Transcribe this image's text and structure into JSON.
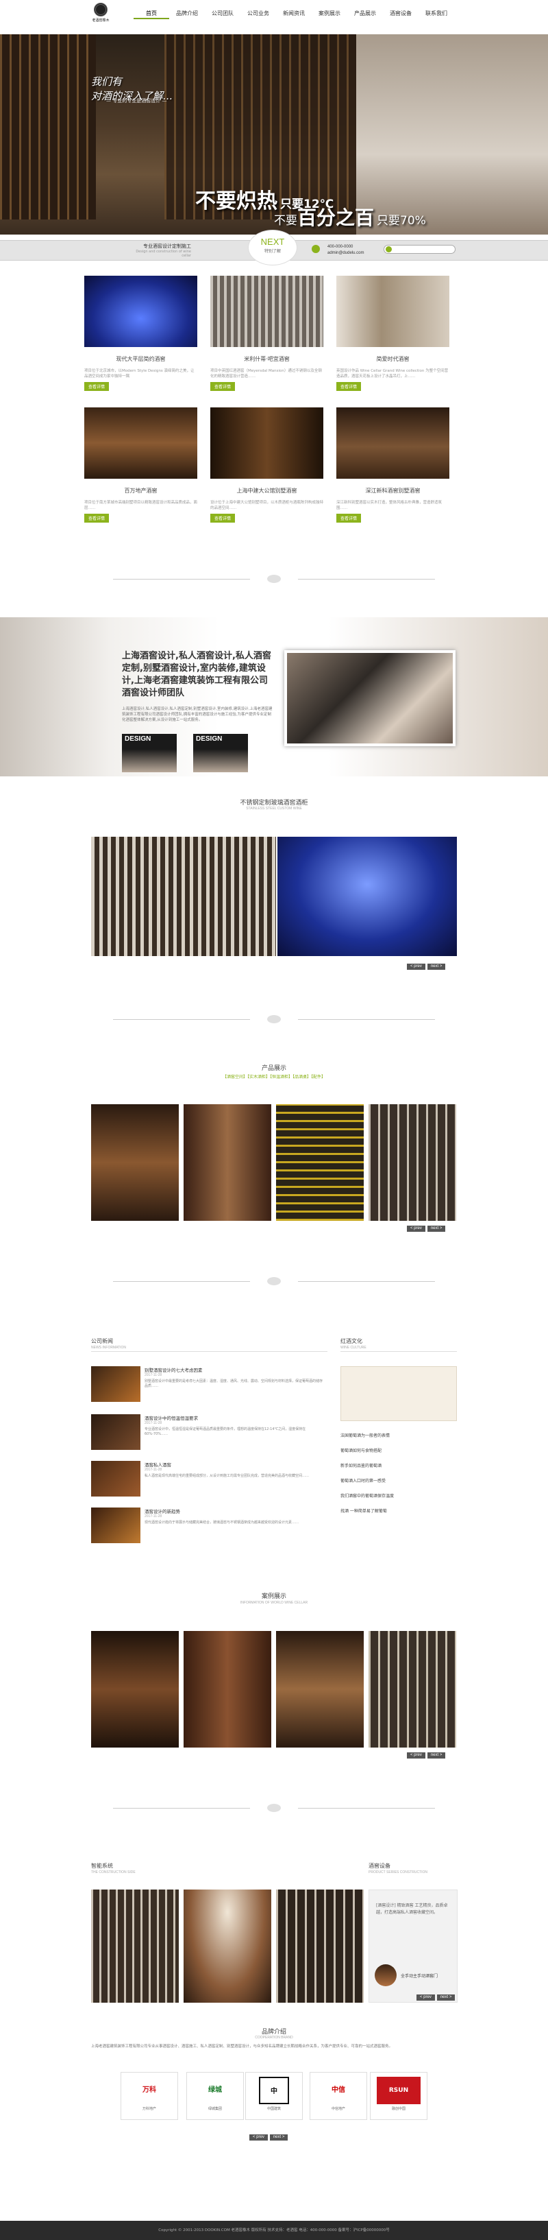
{
  "logo": {
    "cn": "老酒窖橡木"
  },
  "nav": [
    "首页",
    "品牌介绍",
    "公司团队",
    "公司业务",
    "新闻资讯",
    "案例展示",
    "产品展示",
    "酒窖设备",
    "联系我们"
  ],
  "banner": {
    "line1": "我们有",
    "line2": "对酒的深入了解...",
    "line3": "— 专业的专业是酒窖设计 —",
    "big1": "不要炽热",
    "big1b": "只要12℃",
    "big2": "不要",
    "big3": "百分之百",
    "big3b": "只要70%"
  },
  "bar": {
    "l1": "专业酒窖设计定制施工",
    "l2": "Design and construction of wine cellar",
    "next": "NEXT",
    "next_sub": "特别了解",
    "phone": "400-000-0000",
    "email": "admin@dudelu.com"
  },
  "cases": [
    {
      "title": "现代大平层简约酒窖",
      "desc": "项目位于北京城市，以Modern Style Designs 演绎简约之美，让品酒空间成为家中独特一隅",
      "btn": "查看详情"
    },
    {
      "title": "米利什蒂·吧宜酒窖",
      "desc": "项目中英国红酒酒窖（Meyersdal Mansion）通过不锈钢以及全钢化的精致酒窖设计营造……",
      "btn": "查看详情"
    },
    {
      "title": "简爱时代酒窖",
      "desc": "英国设计作品 Wine Cellar Grand Wine collection 为整个空间营造品质，酒窖天花板上设计了水晶吊灯，上……",
      "btn": "查看详情"
    },
    {
      "title": "百万地产酒窖",
      "desc": "项目位于南方某城市高端别墅项目以精致酒窖设计和高品质成品，面层……",
      "btn": "查看详情"
    },
    {
      "title": "上海中建大公馆别墅酒窖",
      "desc": "设计位于上海中建大公馆别墅项目，以木质酒柜与酒瓶陈列构成独特的品酒空间……",
      "btn": "查看详情"
    },
    {
      "title": "深江新科酒窖别墅酒窖",
      "desc": "深江新科别墅酒窖以实木打造，整体风格古朴典雅，营造舒适氛围……",
      "btn": "查看详情"
    }
  ],
  "about": {
    "title": "上海酒窖设计,私人酒窖设计,私人酒窖定制,别墅酒窖设计,室内装修,建筑设计,上海老酒窖建筑装饰工程有限公司酒窖设计师团队",
    "text": "上海酒窖设计,私人酒窖设计,私人酒窖定制,别墅酒窖设计,室内装修,建筑设计,上海老酒窖建筑装饰工程有限公司酒窖设计师团队,拥有丰富的酒窖设计与施工经验,为客户提供专业定制化酒窖整体解决方案,从设计到施工一站式服务。",
    "design": "DESIGN"
  },
  "steel": {
    "title": "不锈钢定制玻璃酒窖酒柜",
    "sub": "STAINLESS STEEL CUSTOM WINE"
  },
  "pager": {
    "prev": "< prev",
    "next": "next >"
  },
  "products": {
    "title": "产品展示",
    "tabs": "【酒窖空间】【实木酒柜】【恒温酒柜】【品酒桌】【配件】"
  },
  "news": {
    "title": "公司新闻",
    "sub": "NEWS INFORMATION",
    "items": [
      {
        "t": "别墅酒窖设计的七大考虑因素",
        "d": "2017-11-28",
        "x": "别墅酒窖设计中最重要的是考虑七大因素：温度、湿度、通风、光线、震动、空间规划与材料选择，保证葡萄酒的储存品质……"
      },
      {
        "t": "酒窖设计中的恒温恒湿要求",
        "d": "2017-11-28",
        "x": "专业酒窖设计中，恒温恒湿是保证葡萄酒品质最重要的条件，理想的温度保持在12-14℃之间，湿度保持在60%-70%……"
      },
      {
        "t": "酒窖私人酒窖",
        "d": "2017-11-28",
        "x": "私人酒窖是现代高端住宅的重要组成部分，从设计到施工均需专业团队完成，营造完美的品酒与收藏空间……"
      },
      {
        "t": "酒窖设计的新趋势",
        "d": "2017-11-28",
        "x": "现代酒窖设计趋向于将展示与储藏完美结合，玻璃酒窖与不锈钢酒架成为越来越受欢迎的设计元素……"
      }
    ]
  },
  "culture": {
    "title": "红酒文化",
    "sub": "WINE CULTURE",
    "items": [
      "法国葡萄酒为一般者的表情",
      "葡萄酒如何与食物搭配",
      "新手如何品鉴的葡萄酒",
      "葡萄酒入口时的第一感受",
      "我们酒窖中的葡萄酒保存温度",
      "找酒 一种简单易了解葡萄"
    ]
  },
  "showcase": {
    "title": "案例展示",
    "sub": "INFORMATION OF WORLD WINE CELLAR"
  },
  "smart": {
    "title": "智能系统",
    "sub": "THE CONSTRUCTION SIDE"
  },
  "equip": {
    "title": "酒窖设备",
    "sub": "PRODUCT SERIES CONSTRUCTION",
    "text": "[酒窖设计] 精致酒窖 工艺精良，品质卓越，打造高端私人酒窖收藏空间。",
    "label": "全手动主手动酒窖门"
  },
  "brands": {
    "title": "品牌介绍",
    "sub": "COOPERATION BRAND",
    "text": "上海老酒窖建筑装饰工程有限公司专业从事酒窖设计、酒窖施工、私人酒窖定制、别墅酒窖设计，与众多知名品牌建立长期战略合作关系，为客户提供专业、可靠的一站式酒窖服务。",
    "items": [
      {
        "logo": "万科",
        "name": "万科地产"
      },
      {
        "logo": "绿城",
        "name": "绿城集团"
      },
      {
        "logo": "中",
        "name": "中国建筑"
      },
      {
        "logo": "中信",
        "name": "中信地产"
      },
      {
        "logo": "RSUN",
        "name": "融创中国"
      }
    ]
  },
  "footer": "Copyright © 2001-2013 DOOKIN.COM 老酒窖橡木 版权所有 技术支持：老酒窖 电话：400-000-0000 备案号：沪ICP备00000000号",
  "colors": {
    "accent": "#8cb31c",
    "footer": "#2b2b2b"
  }
}
